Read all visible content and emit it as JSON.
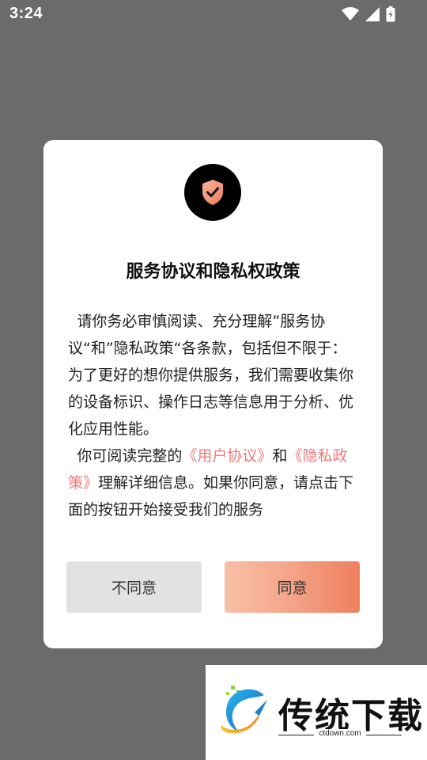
{
  "status_bar": {
    "time": "3:24",
    "icons": [
      "wifi-icon",
      "signal-icon",
      "battery-charging-icon"
    ]
  },
  "dialog": {
    "title": "服务协议和隐私权政策",
    "paragraph1": "请你务必审慎阅读、充分理解”服务协议“和”隐私政策“各条款，包括但不限于：为了更好的想你提供服务，我们需要收集你的设备标识、操作日志等信息用于分析、优化应用性能。",
    "paragraph2": {
      "before": "你可阅读完整的",
      "link1": "《用户协议》",
      "middle": "和",
      "link2": "《隐私政策》",
      "after": "理解详细信息。如果你同意，请点击下面的按钮开始接受我们的服务"
    },
    "buttons": {
      "disagree": "不同意",
      "agree": "同意"
    },
    "colors": {
      "link": "#f07a7a",
      "agree_gradient_start": "#f8c0a8",
      "agree_gradient_end": "#ee7f5e",
      "disagree_bg": "#e2e2e2"
    }
  },
  "watermark": {
    "title": "传统下载",
    "url": "ctdown.com"
  }
}
